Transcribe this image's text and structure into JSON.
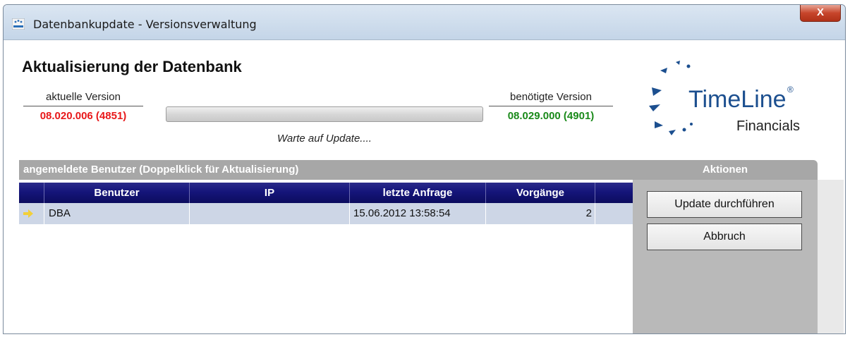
{
  "window": {
    "title": "Datenbankupdate - Versionsverwaltung",
    "close_label": "X"
  },
  "main": {
    "heading": "Aktualisierung der Datenbank",
    "current": {
      "label": "aktuelle Version",
      "value": "08.020.006 (4851)",
      "color": "#e8181a"
    },
    "required": {
      "label": "benötigte Version",
      "value": "08.029.000 (4901)",
      "color": "#1a8a1a"
    },
    "progress": {
      "status_text": "Warte auf Update....",
      "fraction": 0
    }
  },
  "logo": {
    "main": "TimeLine",
    "reg": "®",
    "sub": "Financials",
    "color": "#1c4f8f"
  },
  "users": {
    "header": "angemeldete Benutzer (Doppelklick für Aktualisierung)",
    "columns": [
      "Benutzer",
      "IP",
      "letzte Anfrage",
      "Vorgänge"
    ],
    "rows": [
      {
        "user": "DBA",
        "ip": "",
        "last_request": "15.06.2012 13:58:54",
        "operations": "2"
      }
    ]
  },
  "actions": {
    "header": "Aktionen",
    "update_label": "Update durchführen",
    "cancel_label": "Abbruch"
  }
}
